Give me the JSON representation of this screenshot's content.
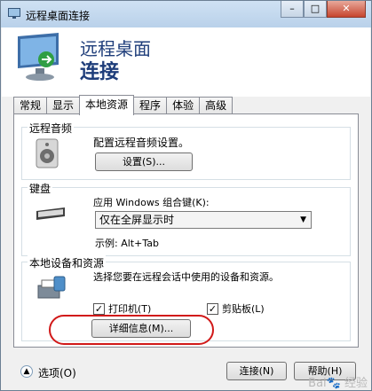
{
  "window": {
    "title": "远程桌面连接",
    "controls": [
      "–",
      "□",
      "✕"
    ]
  },
  "banner": {
    "line1": "远程桌面",
    "line2": "连接"
  },
  "tabs": [
    {
      "label": "常规",
      "active": false
    },
    {
      "label": "显示",
      "active": false
    },
    {
      "label": "本地资源",
      "active": true
    },
    {
      "label": "程序",
      "active": false
    },
    {
      "label": "体验",
      "active": false
    },
    {
      "label": "高级",
      "active": false
    }
  ],
  "audio": {
    "title": "远程音频",
    "desc": "配置远程音频设置。",
    "settings_button": "设置(S)..."
  },
  "keyboard": {
    "title": "键盘",
    "label": "应用 Windows 组合键(K):",
    "selected": "仅在全屏显示时",
    "example": "示例: Alt+Tab"
  },
  "devices": {
    "title": "本地设备和资源",
    "desc": "选择您要在远程会话中使用的设备和资源。",
    "printer": {
      "label": "打印机(T)",
      "checked": true
    },
    "clipboard": {
      "label": "剪贴板(L)",
      "checked": true
    },
    "details_button": "详细信息(M)..."
  },
  "footer": {
    "options": "选项(O)",
    "connect": "连接(N)",
    "help": "帮助(H)",
    "watermark": "Bai🐾 经验"
  },
  "colors": {
    "banner_text": "#1e3d7a",
    "highlight": "#d11919"
  }
}
